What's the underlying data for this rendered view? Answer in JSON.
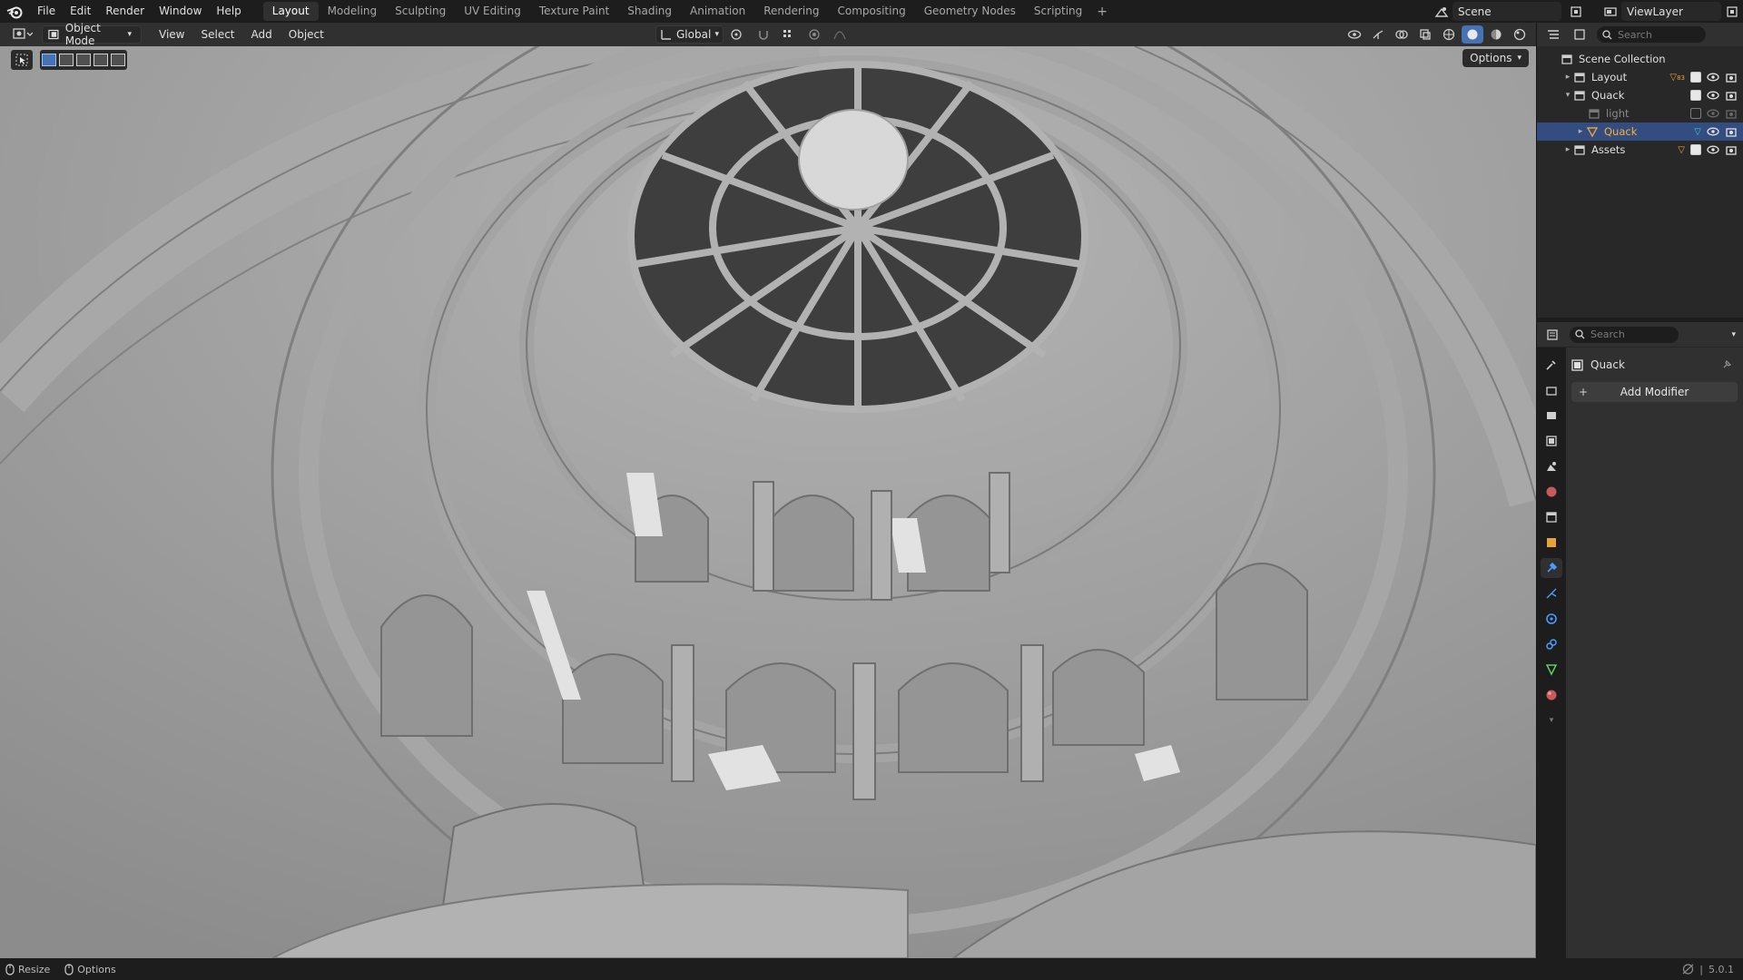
{
  "topbar": {
    "menus": [
      "File",
      "Edit",
      "Render",
      "Window",
      "Help"
    ],
    "workspaces": [
      "Layout",
      "Modeling",
      "Sculpting",
      "UV Editing",
      "Texture Paint",
      "Shading",
      "Animation",
      "Rendering",
      "Compositing",
      "Geometry Nodes",
      "Scripting"
    ],
    "active_workspace": "Layout",
    "add_tab": "+",
    "scene_label": "Scene",
    "view_layer_label": "ViewLayer"
  },
  "viewport_header": {
    "mode": "Object Mode",
    "menus": [
      "View",
      "Select",
      "Add",
      "Object"
    ],
    "orientation": "Global",
    "options_label": "Options"
  },
  "outliner": {
    "search_placeholder": "Search",
    "root": "Scene Collection",
    "items": [
      {
        "label": "Layout",
        "expanded": false,
        "depth": 1
      },
      {
        "label": "Quack",
        "expanded": true,
        "depth": 1
      },
      {
        "label": "light",
        "expanded": false,
        "depth": 2,
        "disabled": true
      },
      {
        "label": "Quack",
        "expanded": false,
        "depth": 2,
        "selected": true
      },
      {
        "label": "Assets",
        "expanded": false,
        "depth": 1
      }
    ],
    "badge_layout": "83"
  },
  "properties": {
    "search_placeholder": "Search",
    "object_name": "Quack",
    "add_modifier_label": "Add Modifier",
    "active_tab": "modifiers"
  },
  "statusbar": {
    "left_items": [
      "Resize",
      "Options"
    ],
    "version": "5.0.1"
  },
  "colors": {
    "accent": "#4772b3",
    "selected_row": "#334d80",
    "object_orange": "#e8a23a",
    "highlight_text": "#ffaf29"
  }
}
